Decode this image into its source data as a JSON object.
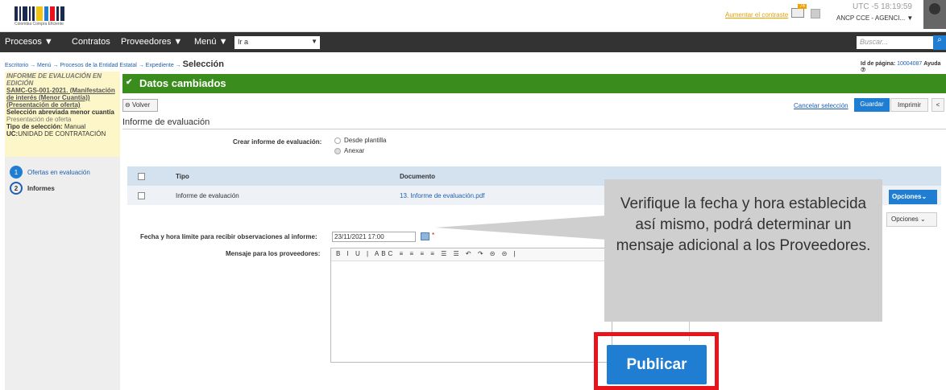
{
  "header": {
    "logo_caption": "Colombia Compra Eficiente",
    "contrast_link": "Aumentar el contraste",
    "mail_badge": "74",
    "utc_label": "UTC -5",
    "time": "18:19:59",
    "account": "ANCP CCE - AGENCI..."
  },
  "nav": {
    "items": [
      "Procesos ▼",
      "Contratos",
      "Proveedores ▼",
      "Menú ▼"
    ],
    "goto_value": "Ir a",
    "search_placeholder": "Buscar..."
  },
  "breadcrumb": {
    "trail": "Escritorio → Menú → Procesos de la Entidad Estatal → Expediente →",
    "current": "Selección"
  },
  "page_id": {
    "label": "Id de página:",
    "value": "10004087",
    "help": "Ayuda ⑦"
  },
  "sidebar": {
    "heading": "INFORME DE EVALUACIÓN EN EDICIÓN",
    "process_link": "SAMC-GS-001-2021. (Manifestación de interés (Menor Cuantía)) (Presentación de oferta)",
    "process_type": "Selección abreviada menor cuantía",
    "phase": "Presentación de oferta",
    "selection_label": "Tipo de selección:",
    "selection_value": "Manual",
    "uc_label": "UC:",
    "uc_value": "UNIDAD DE CONTRATACIÓN",
    "steps": [
      {
        "num": "1",
        "label": "Ofertas en evaluación"
      },
      {
        "num": "2",
        "label": "Informes"
      }
    ]
  },
  "banner": {
    "text": "Datos cambiados"
  },
  "toolbar": {
    "back": "Volver",
    "cancel": "Cancelar selección",
    "save": "Guardar",
    "print": "Imprimir",
    "collapse": "<"
  },
  "section": {
    "title": "Informe de evaluación"
  },
  "create_report": {
    "label": "Crear informe de evaluación:",
    "options": [
      "Desde plantilla",
      "Anexar"
    ]
  },
  "table": {
    "headers": [
      "Tipo",
      "Documento"
    ],
    "rows": [
      {
        "tipo": "Informe de evaluación",
        "documento": "13. Informe de evaluación.pdf"
      }
    ],
    "options_primary": "Opciones",
    "options_secondary": "Opciones"
  },
  "deadline": {
    "label": "Fecha y hora límite para recibir observaciones al informe:",
    "value": "23/11/2021 17:00",
    "required": "*"
  },
  "message": {
    "label": "Mensaje para los proveedores:",
    "toolbar": "B I U | ABC ≡ ≡ ≡ ≡ ☰ ☰ ↶ ↷ ⊝ ⊝ |"
  },
  "callout": {
    "text": "Verifique la fecha y hora establecida así mismo, podrá determinar un mensaje adicional a los Proveedores."
  },
  "publish": {
    "label": "Publicar"
  },
  "colors": {
    "green": "#3a8d1c",
    "blue": "#1f7ed1",
    "red": "#e8141b",
    "nav": "#333333"
  }
}
